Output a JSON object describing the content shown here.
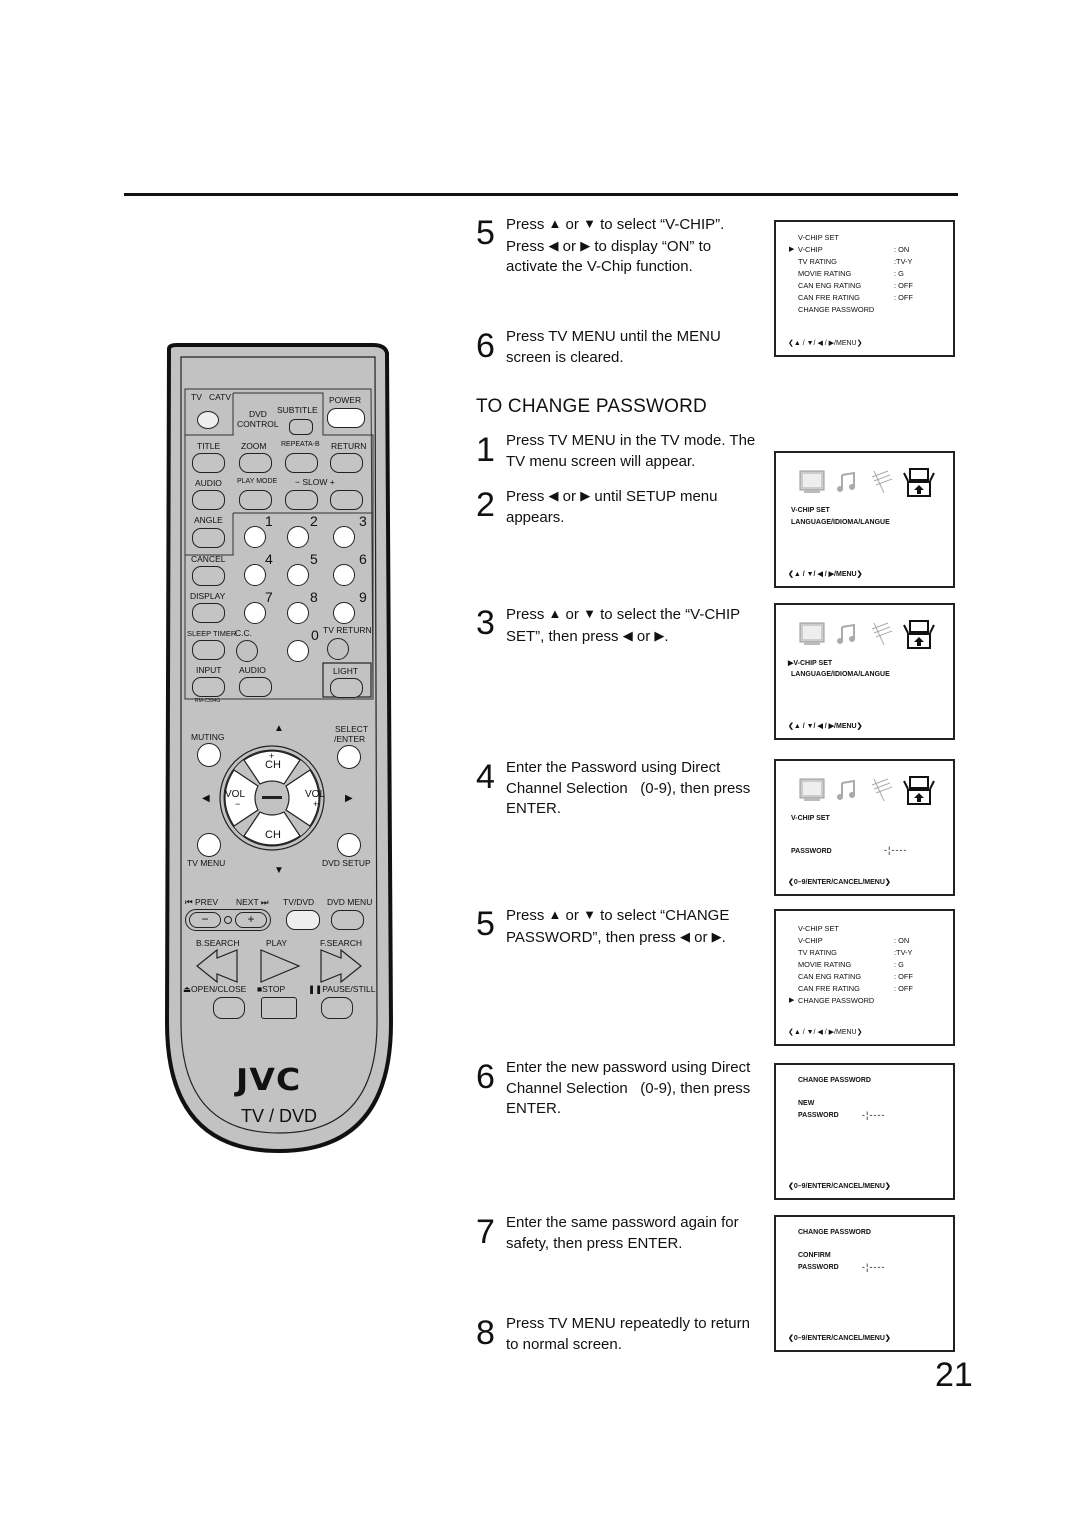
{
  "page": {
    "number": "21"
  },
  "top_steps": [
    {
      "num": "5",
      "parts": [
        "Press ",
        "▲",
        " or ",
        "▼",
        " to select “V-CHIP”. Press ",
        "◀",
        " or ",
        "▶",
        " to display “ON” to activate the V-Chip function."
      ]
    },
    {
      "num": "6",
      "text": "Press TV MENU until the MENU screen is cleared."
    }
  ],
  "section": {
    "title": "TO CHANGE PASSWORD"
  },
  "steps": [
    {
      "num": "1",
      "text": "Press TV MENU in the TV mode. The TV menu screen will appear."
    },
    {
      "num": "2",
      "a": "Press ",
      "b": " or ",
      "c": " until SETUP menu appears."
    },
    {
      "num": "3",
      "a": "Press ",
      "b": " or ",
      "c": " to select the “V-CHIP SET”, then press ",
      "d": " or ",
      "e": "."
    },
    {
      "num": "4",
      "text": "Enter the Password using Direct Channel Selection   (0-9), then press ENTER."
    },
    {
      "num": "5",
      "a": "Press ",
      "b": " or ",
      "c": " to select “CHANGE PASSWORD”, then press ",
      "d": " or ",
      "e": "."
    },
    {
      "num": "6",
      "text": "Enter the new password using Direct Channel Selection   (0-9), then press ENTER."
    },
    {
      "num": "7",
      "text": "Enter the same password again for safety, then press ENTER."
    },
    {
      "num": "8",
      "text": "Press TV MENU repeatedly to return to normal screen."
    }
  ],
  "glyphs": {
    "up": "▲",
    "down": "▼",
    "left": "◀",
    "right": "▶",
    "cursor": "▶"
  },
  "vchip_menu": {
    "title": "V-CHIP SET",
    "rows": [
      {
        "label": "V-CHIP",
        "value": ": ON"
      },
      {
        "label": "TV RATING",
        "value": ":TV-Y"
      },
      {
        "label": "MOVIE RATING",
        "value": ": G"
      },
      {
        "label": "CAN ENG RATING",
        "value": ": OFF"
      },
      {
        "label": "CAN FRE RATING",
        "value": ": OFF"
      },
      {
        "label": "CHANGE PASSWORD",
        "value": ""
      }
    ],
    "footer": "❮▲ / ▼/ ◀ / ▶/MENU❯"
  },
  "setup_menu": {
    "items": [
      "V-CHIP SET",
      "LANGUAGE/IDIOMA/LANGUE"
    ],
    "footer": "❮▲ / ▼/ ◀ / ▶/MENU❯"
  },
  "password_screen": {
    "item": "V-CHIP SET",
    "label": "PASSWORD",
    "dashes": "-¦----",
    "footer": "❮0–9/ENTER/CANCEL/MENU❯"
  },
  "new_password_screen": {
    "title": "CHANGE PASSWORD",
    "label1": "NEW",
    "label2": "PASSWORD",
    "footer": "❮0–9/ENTER/CANCEL/MENU❯"
  },
  "confirm_password_screen": {
    "title": "CHANGE PASSWORD",
    "label1": "CONFIRM",
    "label2": "PASSWORD",
    "footer": "❮0–9/ENTER/CANCEL/MENU❯"
  },
  "remote": {
    "labels": {
      "tv": "TV",
      "catv": "CATV",
      "power": "POWER",
      "dvd_control": "DVD",
      "control": "CONTROL",
      "subtitle": "SUBTITLE",
      "title": "TITLE",
      "zoom": "ZOOM",
      "repeat": "REPEATA-B",
      "return": "RETURN",
      "audio": "AUDIO",
      "play_mode": "PLAY MODE",
      "slow": "−  SLOW  +",
      "angle": "ANGLE",
      "cancel": "CANCEL",
      "display": "DISPLAY",
      "sleep": "SLEEP TIMER",
      "cc": "C.C.",
      "tv_return": "TV RETURN",
      "input": "INPUT",
      "audio2": "AUDIO",
      "light": "LIGHT",
      "model": "RM-C394G",
      "muting": "MUTING",
      "select": "SELECT",
      "enter": "/ENTER",
      "ch": "CH",
      "vol": "VOL",
      "tv_menu": "TV MENU",
      "dvd_setup": "DVD SETUP",
      "prev": "⏮ PREV",
      "next": "NEXT ⏭",
      "tvdvd": "TV/DVD",
      "dvd_menu": "DVD MENU",
      "bsearch": "B.SEARCH",
      "play": "PLAY",
      "fsearch": "F.SEARCH",
      "open": "⏏OPEN/CLOSE",
      "stop": "■STOP",
      "pause": "❚❚PAUSE/STILL"
    },
    "digits": [
      "1",
      "2",
      "3",
      "4",
      "5",
      "6",
      "7",
      "8",
      "9",
      "0"
    ],
    "brand": "JVC",
    "brand_sub": "TV / DVD"
  }
}
